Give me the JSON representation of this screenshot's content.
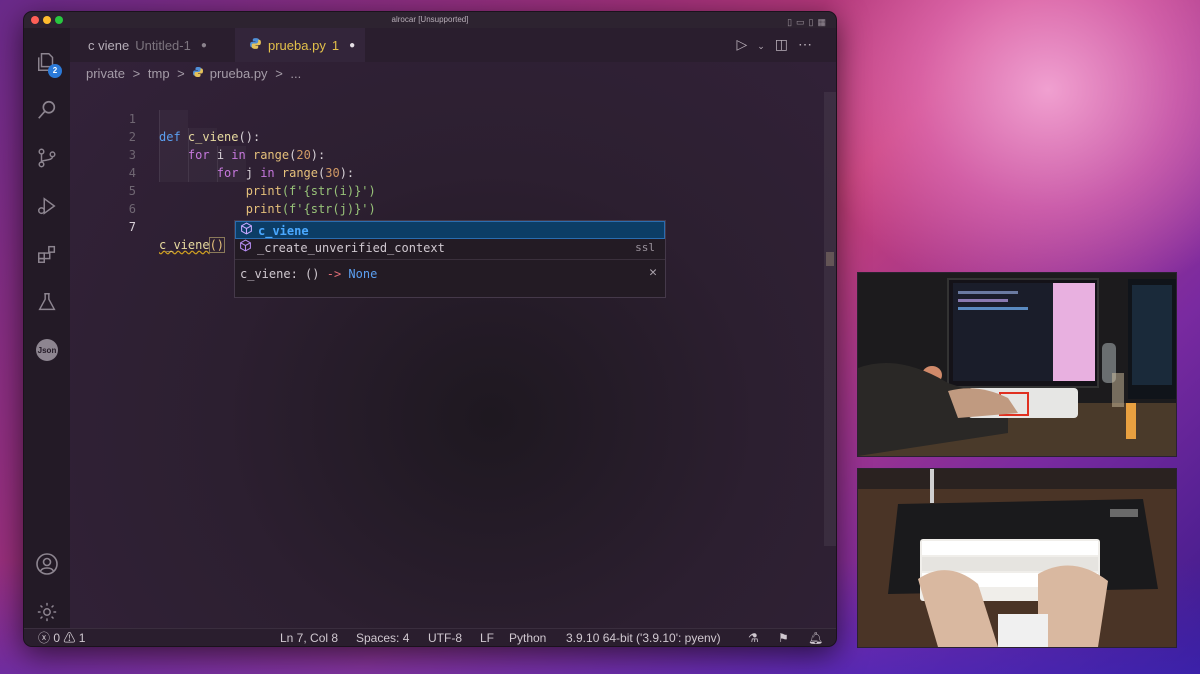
{
  "window": {
    "title": "alrocar [Unsupported]"
  },
  "activity_bar": {
    "explorer_badge": "2",
    "json_label": "Json"
  },
  "tabs": [
    {
      "label": "c viene",
      "sublabel": "Untitled-1",
      "dirty": "●"
    },
    {
      "label": "prueba.py",
      "sublabel": "1",
      "dirty": "●"
    }
  ],
  "breadcrumb": [
    "private",
    ">",
    "tmp",
    ">",
    "prueba.py",
    ">",
    "..."
  ],
  "code": {
    "line_numbers": [
      "1",
      "2",
      "3",
      "4",
      "5",
      "6",
      "7"
    ],
    "lines": {
      "l1": {
        "kw": "def",
        "fn": "c_viene",
        "rest": "():"
      },
      "l2": {
        "kw": "for",
        "var": "i",
        "kw2": "in",
        "fn": "range",
        "open": "(",
        "num": "20",
        "close": "):"
      },
      "l3": {
        "kw": "for",
        "var": "j",
        "kw2": "in",
        "fn": "range",
        "open": "(",
        "num": "30",
        "close": "):"
      },
      "l4": {
        "fn": "print",
        "str": "(f'{str(i)}')"
      },
      "l5": {
        "fn": "print",
        "str": "(f'{str(j)}')"
      },
      "l7": {
        "call": "c_viene",
        "parens": "()"
      }
    }
  },
  "suggest": {
    "items": [
      {
        "pre": "",
        "match": "c_viene",
        "post": "",
        "detail": ""
      },
      {
        "label": "_create_unverified_context",
        "detail": "ssl"
      }
    ],
    "doc_name": "c_viene:",
    "doc_sig": "()",
    "doc_arrow": "->",
    "doc_ret": "None"
  },
  "status": {
    "errors": "0",
    "warnings": "1",
    "position": "Ln 7, Col 8",
    "spaces": "Spaces: 4",
    "encoding": "UTF-8",
    "eol": "LF",
    "language": "Python",
    "interpreter": "3.9.10 64-bit ('3.9.10': pyenv)"
  }
}
